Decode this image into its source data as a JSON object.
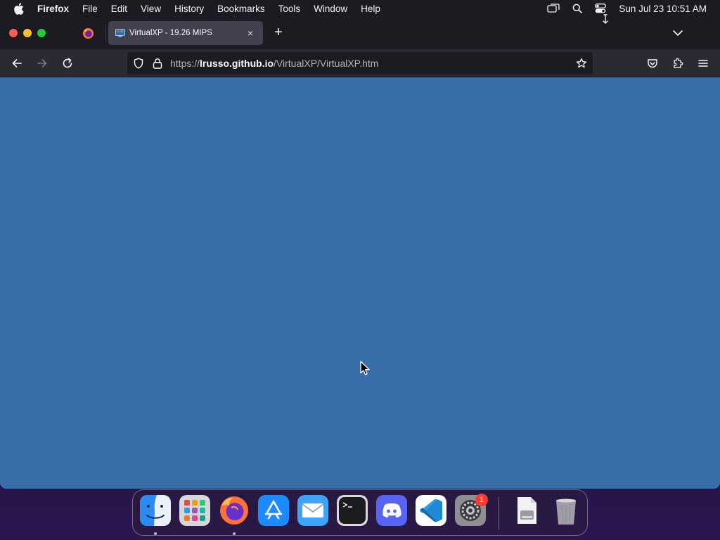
{
  "menubar": {
    "app_name": "Firefox",
    "items": [
      "File",
      "Edit",
      "View",
      "History",
      "Bookmarks",
      "Tools",
      "Window",
      "Help"
    ],
    "clock": "Sun Jul 23  10:51 AM"
  },
  "browser": {
    "tab": {
      "title": "VirtualXP - 19.26 MIPS",
      "close_glyph": "×"
    },
    "newtab_glyph": "+",
    "url": {
      "scheme": "https://",
      "host": "lrusso.github.io",
      "path": "/VirtualXP/VirtualXP.htm"
    },
    "content_color": "#3a6ea8"
  },
  "dock": {
    "items": [
      {
        "name": "Finder",
        "running": true
      },
      {
        "name": "Launchpad",
        "running": false
      },
      {
        "name": "Firefox",
        "running": true
      },
      {
        "name": "App Store",
        "running": false
      },
      {
        "name": "Mail",
        "running": false
      },
      {
        "name": "Terminal",
        "running": false
      },
      {
        "name": "Discord",
        "running": false
      },
      {
        "name": "Visual Studio Code",
        "running": false
      },
      {
        "name": "System Settings",
        "running": false,
        "badge": "1"
      },
      {
        "name": "Disk Image",
        "running": false
      },
      {
        "name": "Trash",
        "running": false
      }
    ]
  },
  "colors": {
    "menubar": "#1d1b22",
    "tabstrip": "#1c1b22",
    "navbar": "#2b2a33",
    "page_background": "#3a6ea8"
  },
  "icons": {
    "apple": "apple-logo-icon",
    "screen_mirroring": "display-icon",
    "spotlight": "search-icon",
    "control_center": "control-center-icon"
  }
}
